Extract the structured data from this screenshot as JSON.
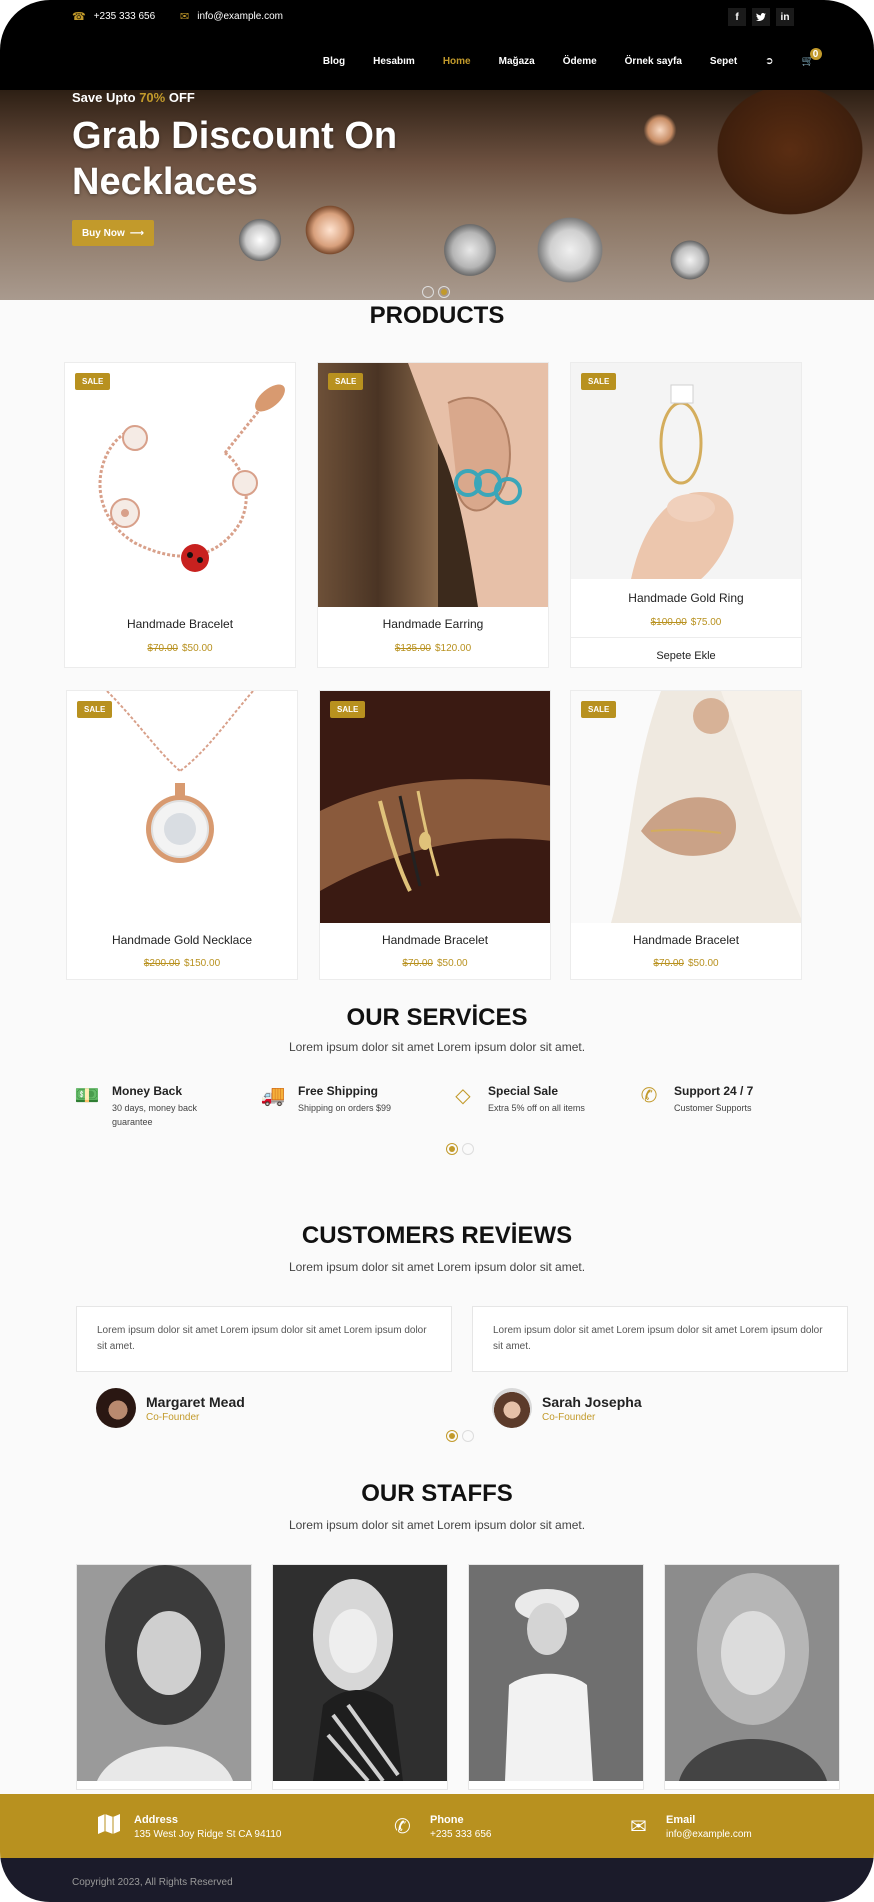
{
  "topbar": {
    "phone": "+235 333 656",
    "email": "info@example.com",
    "social": [
      "f",
      "t",
      "in"
    ]
  },
  "nav": {
    "items": [
      "Blog",
      "Hesabım",
      "Home",
      "Mağaza",
      "Ödeme",
      "Örnek sayfa",
      "Sepet"
    ],
    "active": "Home",
    "cart_count": "0"
  },
  "hero": {
    "pre": "Save Upto",
    "pct": "70%",
    "post": "OFF",
    "title": "Grab Discount On Necklaces",
    "button": "Buy Now"
  },
  "products": {
    "title": "PRODUCTS",
    "sale_label": "SALE",
    "add_to_cart": "Sepete Ekle",
    "items": [
      {
        "name": "Handmade Bracelet",
        "old": "$70.00",
        "new": "$50.00"
      },
      {
        "name": "Handmade Earring",
        "old": "$135.00",
        "new": "$120.00"
      },
      {
        "name": "Handmade Gold Ring",
        "old": "$100.00",
        "new": "$75.00"
      },
      {
        "name": "Handmade Gold Necklace",
        "old": "$200.00",
        "new": "$150.00"
      },
      {
        "name": "Handmade Bracelet",
        "old": "$70.00",
        "new": "$50.00"
      },
      {
        "name": "Handmade Bracelet",
        "old": "$70.00",
        "new": "$50.00"
      }
    ]
  },
  "services": {
    "title": "OUR SERVİCES",
    "subtitle": "Lorem ipsum dolor sit amet Lorem ipsum dolor sit amet.",
    "items": [
      {
        "title": "Money Back",
        "desc": "30 days, money back guarantee"
      },
      {
        "title": "Free Shipping",
        "desc": "Shipping on orders $99"
      },
      {
        "title": "Special Sale",
        "desc": "Extra 5% off on all items"
      },
      {
        "title": "Support 24 / 7",
        "desc": "Customer Supports"
      }
    ]
  },
  "reviews": {
    "title": "CUSTOMERS REVİEWS",
    "subtitle": "Lorem ipsum dolor sit amet Lorem ipsum dolor sit amet.",
    "items": [
      {
        "text": "Lorem ipsum dolor sit amet Lorem ipsum dolor sit amet Lorem ipsum dolor sit amet.",
        "name": "Margaret Mead",
        "role": "Co-Founder"
      },
      {
        "text": "Lorem ipsum dolor sit amet Lorem ipsum dolor sit amet Lorem ipsum dolor sit amet.",
        "name": "Sarah Josepha",
        "role": "Co-Founder"
      }
    ]
  },
  "staff": {
    "title": "OUR STAFFS",
    "subtitle": "Lorem ipsum dolor sit amet Lorem ipsum dolor sit amet."
  },
  "footer": {
    "address_label": "Address",
    "address": "135 West Joy Ridge St CA 94110",
    "phone_label": "Phone",
    "phone": "+235 333 656",
    "email_label": "Email",
    "email": "info@example.com",
    "copyright": "Copyright 2023, All Rights Reserved"
  },
  "colors": {
    "accent": "#c29a2b",
    "footer": "#b8911f",
    "dark": "#000000"
  }
}
